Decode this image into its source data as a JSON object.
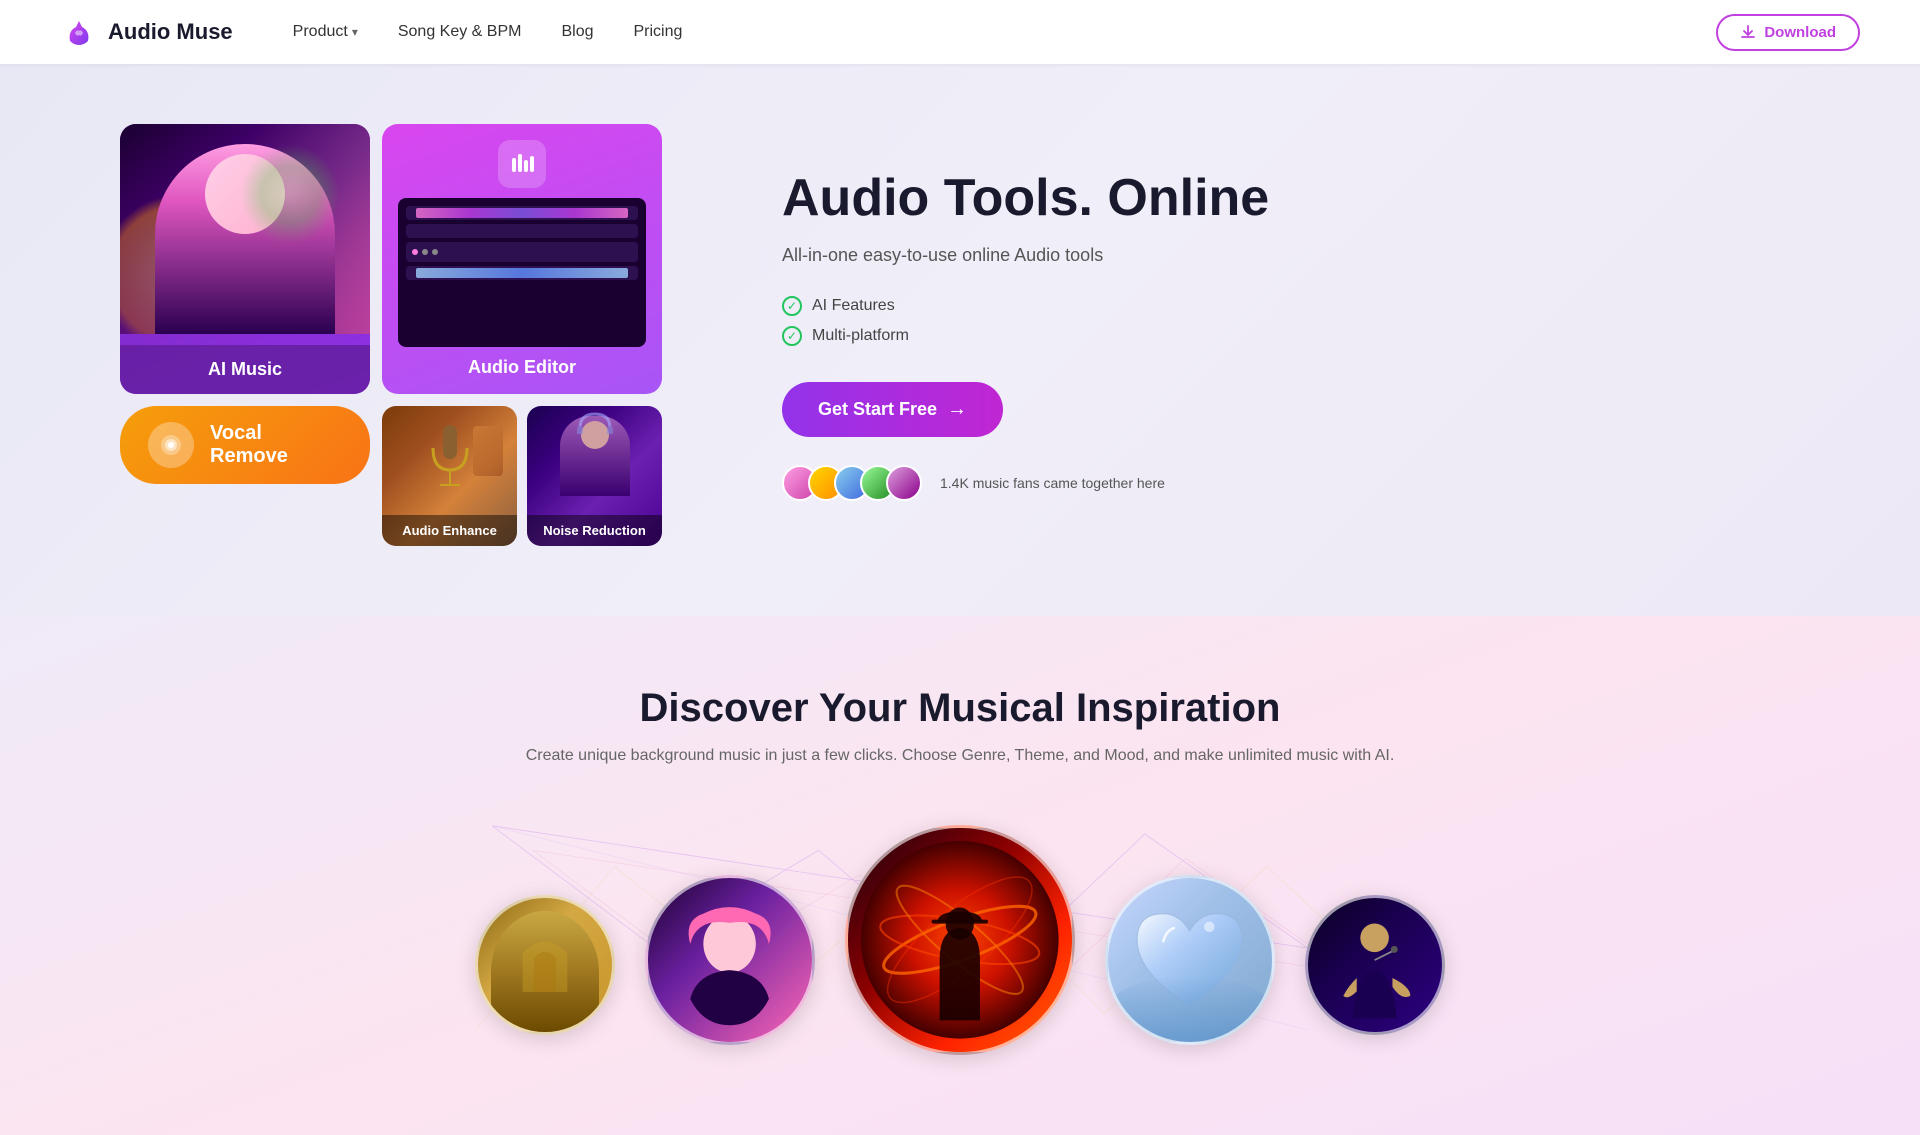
{
  "navbar": {
    "logo_text": "Audio Muse",
    "nav_items": [
      {
        "label": "Product",
        "has_dropdown": true
      },
      {
        "label": "Song Key & BPM",
        "has_dropdown": false
      },
      {
        "label": "Blog",
        "has_dropdown": false
      },
      {
        "label": "Pricing",
        "has_dropdown": false
      }
    ],
    "download_btn": "Download"
  },
  "hero": {
    "cards": {
      "ai_music_label": "AI Music",
      "vocal_remove_label": "Vocal Remove",
      "audio_editor_label": "Audio Editor",
      "audio_enhance_label": "Audio Enhance",
      "noise_reduction_label": "Noise Reduction"
    },
    "title": "Audio Tools. Online",
    "subtitle": "All-in-one easy-to-use online Audio tools",
    "features": [
      {
        "text": "AI Features"
      },
      {
        "text": "Multi-platform"
      }
    ],
    "cta_label": "Get Start Free",
    "cta_arrow": "→",
    "social_proof_text": "1.4K music fans came together here"
  },
  "discover": {
    "title": "Discover Your Musical Inspiration",
    "subtitle": "Create unique background music in just a few clicks. Choose Genre, Theme, and Mood, and make unlimited music with AI."
  }
}
